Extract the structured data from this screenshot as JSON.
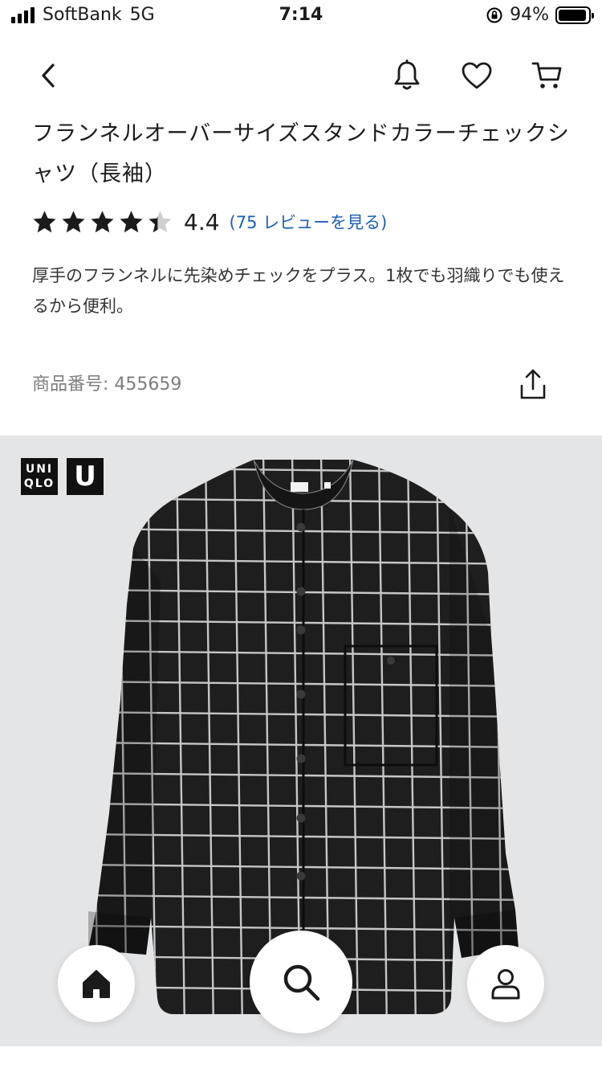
{
  "status_bar": {
    "carrier": "SoftBank",
    "network": "5G",
    "time": "7:14",
    "battery": "94%",
    "battery_level": 0.94
  },
  "nav": {
    "back_icon": "chevron-left-icon",
    "bell_icon": "bell-icon",
    "heart_icon": "heart-icon",
    "cart_icon": "cart-icon"
  },
  "product": {
    "title": "フランネルオーバーサイズスタンドカラーチェックシャツ（長袖）",
    "rating": 4.4,
    "rating_text": "4.4",
    "review_link": "(75 レビューを見る)",
    "description": "厚手のフランネルに先染めチェックをプラス。1枚でも羽織りでも使えるから便利。",
    "product_code": "商品番号: 455659"
  },
  "image": {
    "logo_uniqlo_line1": "UNI",
    "logo_uniqlo_line2": "QLO",
    "logo_u": "U",
    "label_text": "UNIQLO U"
  },
  "bottom_nav": {
    "home_icon": "home-icon",
    "search_icon": "search-icon",
    "account_icon": "account-icon"
  },
  "colors": {
    "link": "#1d5fb5",
    "image_bg": "#e4e5e7",
    "shirt": "#1e1e1f"
  }
}
